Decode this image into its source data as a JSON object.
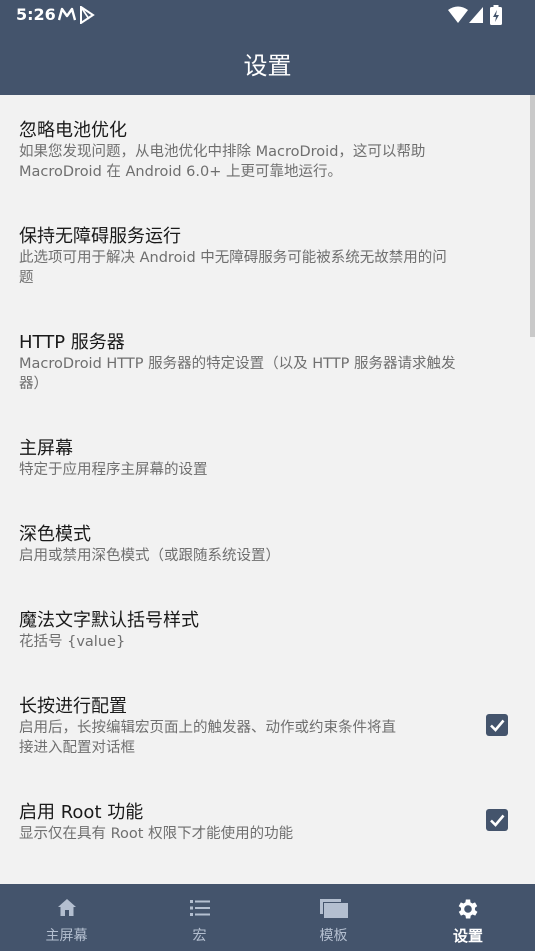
{
  "status": {
    "time": "5:26"
  },
  "header": {
    "title": "设置"
  },
  "prefs": [
    {
      "title": "忽略电池优化",
      "summary1": "如果您发现问题，从电池优化中排除 MacroDroid，这可以帮助",
      "summary2": "MacroDroid 在 Android 6.0+ 上更可靠地运行。"
    },
    {
      "title": "保持无障碍服务运行",
      "summary1": "此选项可用于解决 Android 中无障碍服务可能被系统无故禁用的问",
      "summary2": "题"
    },
    {
      "title": "HTTP 服务器",
      "summary1": "MacroDroid HTTP 服务器的特定设置（以及 HTTP 服务器请求触发",
      "summary2": "器）"
    },
    {
      "title": "主屏幕",
      "summary1": "特定于应用程序主屏幕的设置"
    },
    {
      "title": "深色模式",
      "summary1": "启用或禁用深色模式（或跟随系统设置）"
    },
    {
      "title": "魔法文字默认括号样式",
      "summary1": "花括号 {value}"
    },
    {
      "title": "长按进行配置",
      "summary1": "启用后，长按编辑宏页面上的触发器、动作或约束条件将直",
      "summary2": "接进入配置对话框",
      "checked": true
    },
    {
      "title": "启用 Root 功能",
      "summary1": "显示仅在具有 Root 权限下才能使用的功能",
      "checked": true
    }
  ],
  "nav": [
    {
      "label": "主屏幕",
      "icon": "home-icon"
    },
    {
      "label": "宏",
      "icon": "list-icon"
    },
    {
      "label": "模板",
      "icon": "templates-icon"
    },
    {
      "label": "设置",
      "icon": "gear-icon",
      "active": true
    }
  ],
  "colors": {
    "primary": "#44546c",
    "background": "#f2f2f2",
    "nav_inactive": "#b4bfd0"
  }
}
